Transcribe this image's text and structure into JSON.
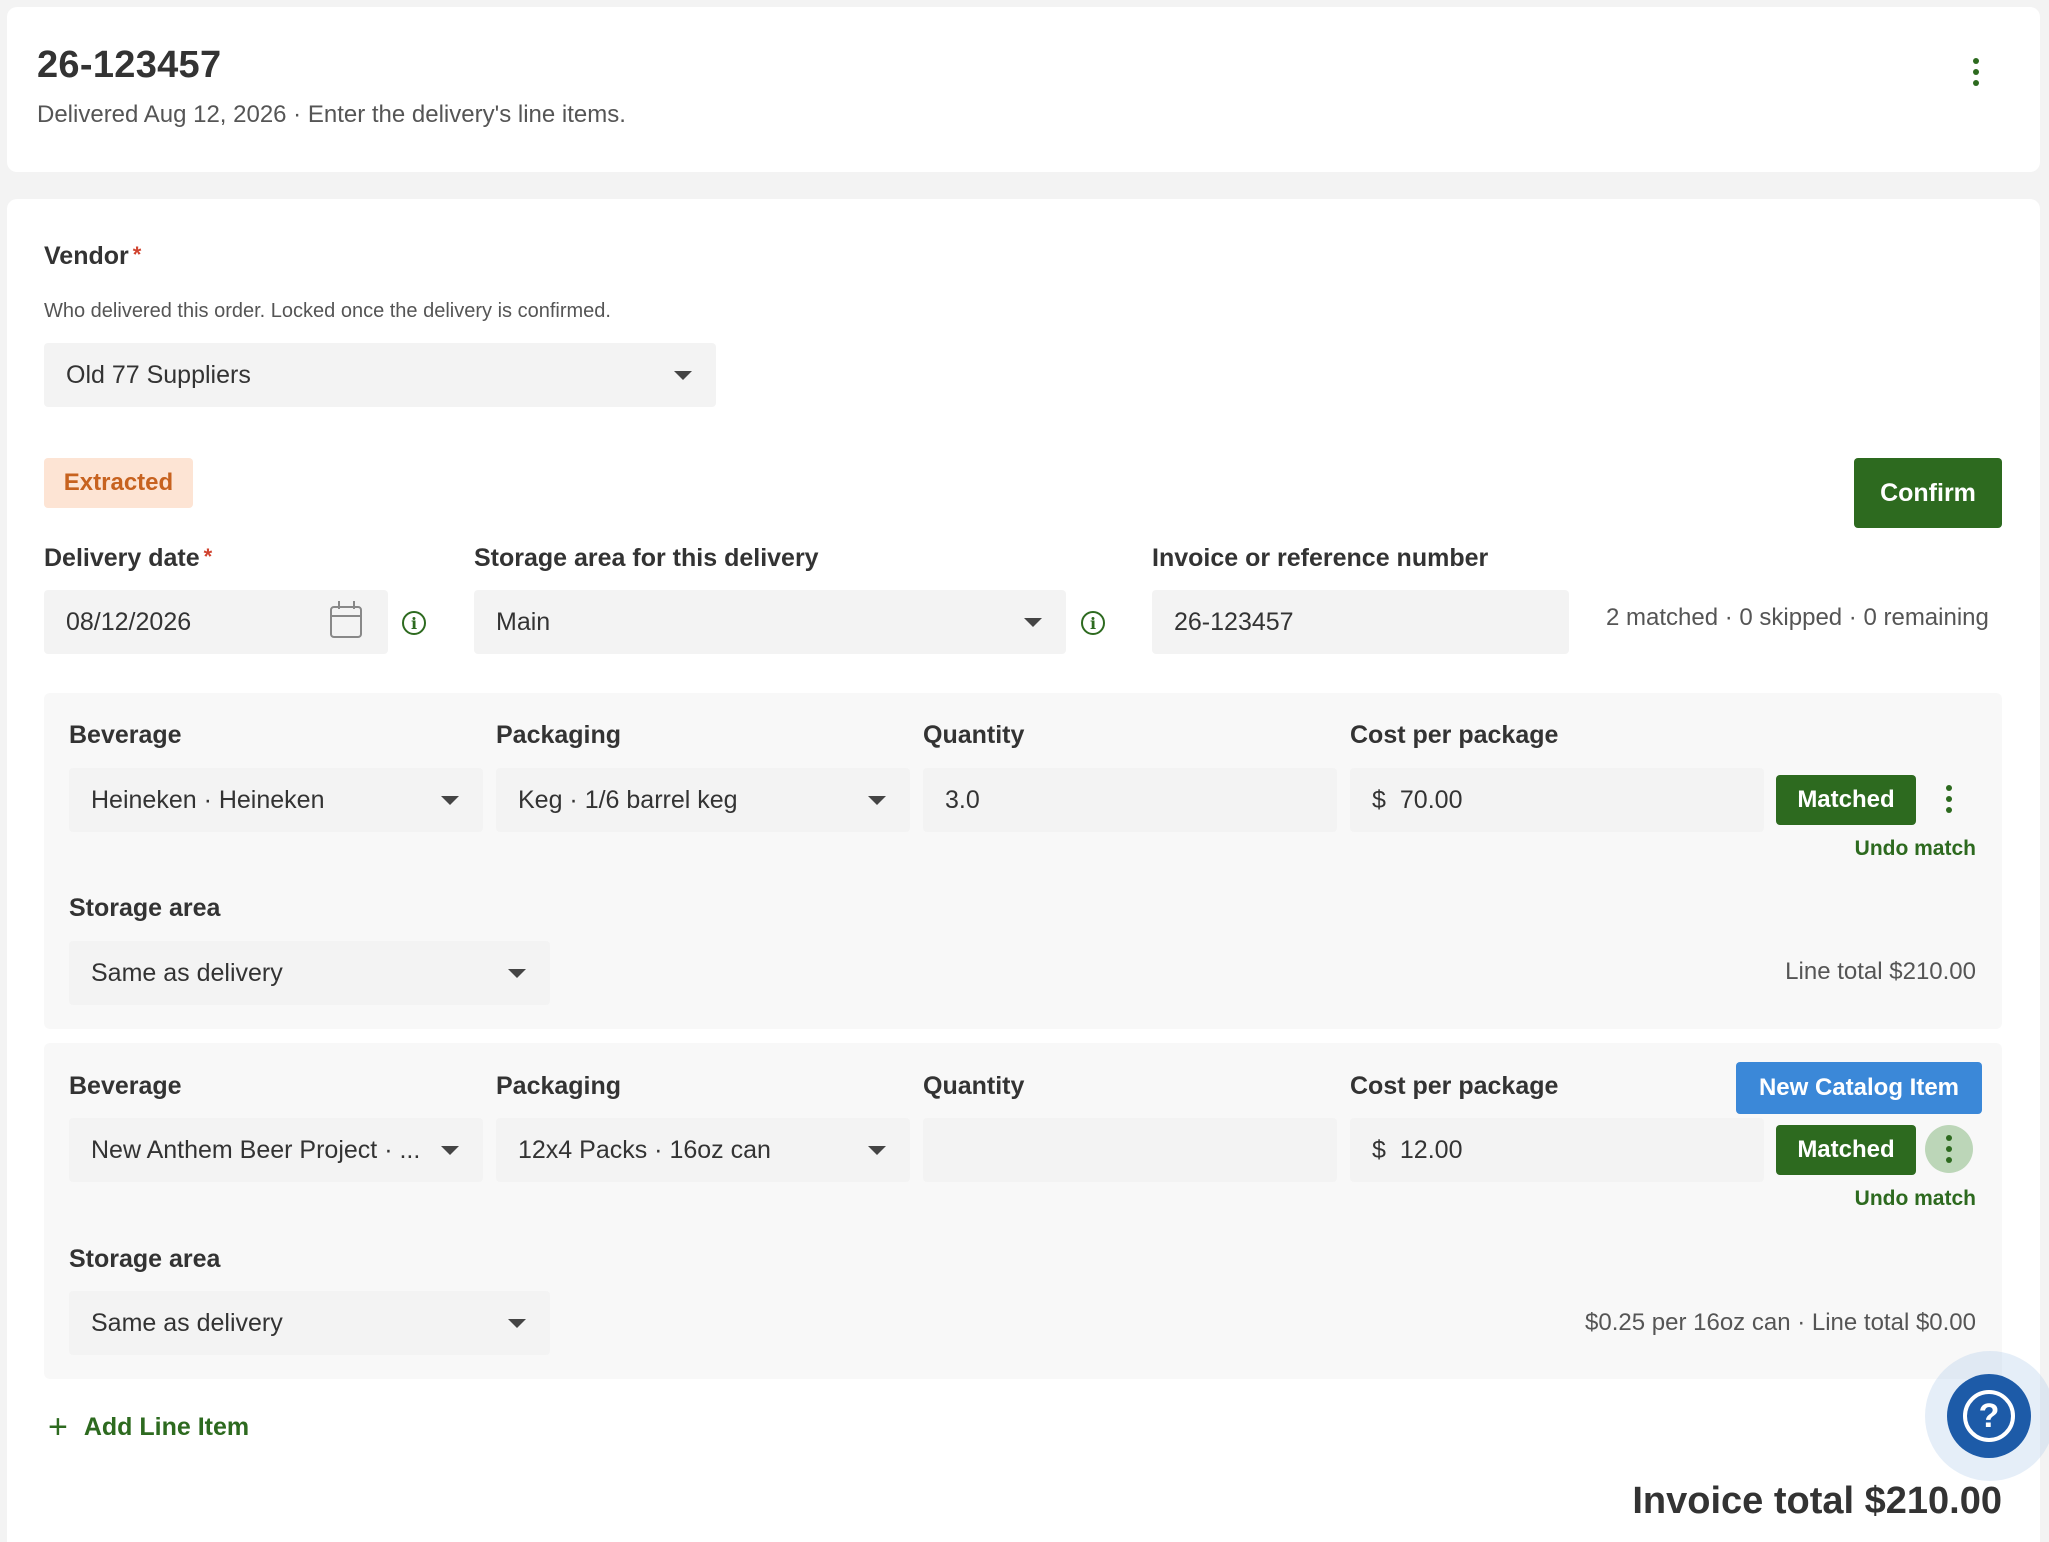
{
  "header": {
    "title": "26-123457",
    "subtitle": "Delivered Aug 12, 2026 · Enter the delivery's line items."
  },
  "vendor": {
    "label": "Vendor",
    "required_mark": "*",
    "helper": "Who delivered this order. Locked once the delivery is confirmed.",
    "value": "Old 77 Suppliers"
  },
  "status_badge": "Extracted",
  "confirm_label": "Confirm",
  "delivery_date": {
    "label": "Delivery date",
    "required_mark": "*",
    "value": "08/12/2026"
  },
  "storage": {
    "label": "Storage area for this delivery",
    "value": "Main"
  },
  "invoice_ref": {
    "label": "Invoice or reference number",
    "value": "26-123457"
  },
  "summary": "2 matched · 0 skipped · 0 remaining",
  "line_items": [
    {
      "beverage_label": "Beverage",
      "beverage": "Heineken · Heineken",
      "packaging_label": "Packaging",
      "packaging": "Keg · 1/6 barrel keg",
      "quantity_label": "Quantity",
      "quantity": "3.0",
      "cost_label": "Cost per package",
      "currency": "$",
      "cost": "70.00",
      "status": "Matched",
      "undo": "Undo match",
      "storage_label": "Storage area",
      "storage": "Same as delivery",
      "note": "Line total $210.00"
    },
    {
      "beverage_label": "Beverage",
      "beverage": "New Anthem Beer Project · ...",
      "packaging_label": "Packaging",
      "packaging": "12x4 Packs · 16oz can",
      "quantity_label": "Quantity",
      "quantity": "",
      "cost_label": "Cost per package",
      "currency": "$",
      "cost": "12.00",
      "status": "Matched",
      "undo": "Undo match",
      "new_catalog": "New Catalog Item",
      "storage_label": "Storage area",
      "storage": "Same as delivery",
      "note": "$0.25 per 16oz can · Line total $0.00"
    }
  ],
  "add_line_label": "Add Line Item",
  "invoice_total": "Invoice total $210.00",
  "help_glyph": "?",
  "icons": {
    "kebab": "vertical-ellipsis-icon",
    "caret": "chevron-down-icon",
    "calendar": "calendar-icon",
    "info": "info-icon",
    "plus": "plus-icon",
    "help": "help-chat-icon"
  },
  "colors": {
    "accent_green": "#2d6a1f",
    "extracted_bg": "#fde4d4",
    "extracted_text": "#c7621f",
    "new_catalog_blue": "#3b88d8",
    "help_blue": "#1d5ba8"
  }
}
